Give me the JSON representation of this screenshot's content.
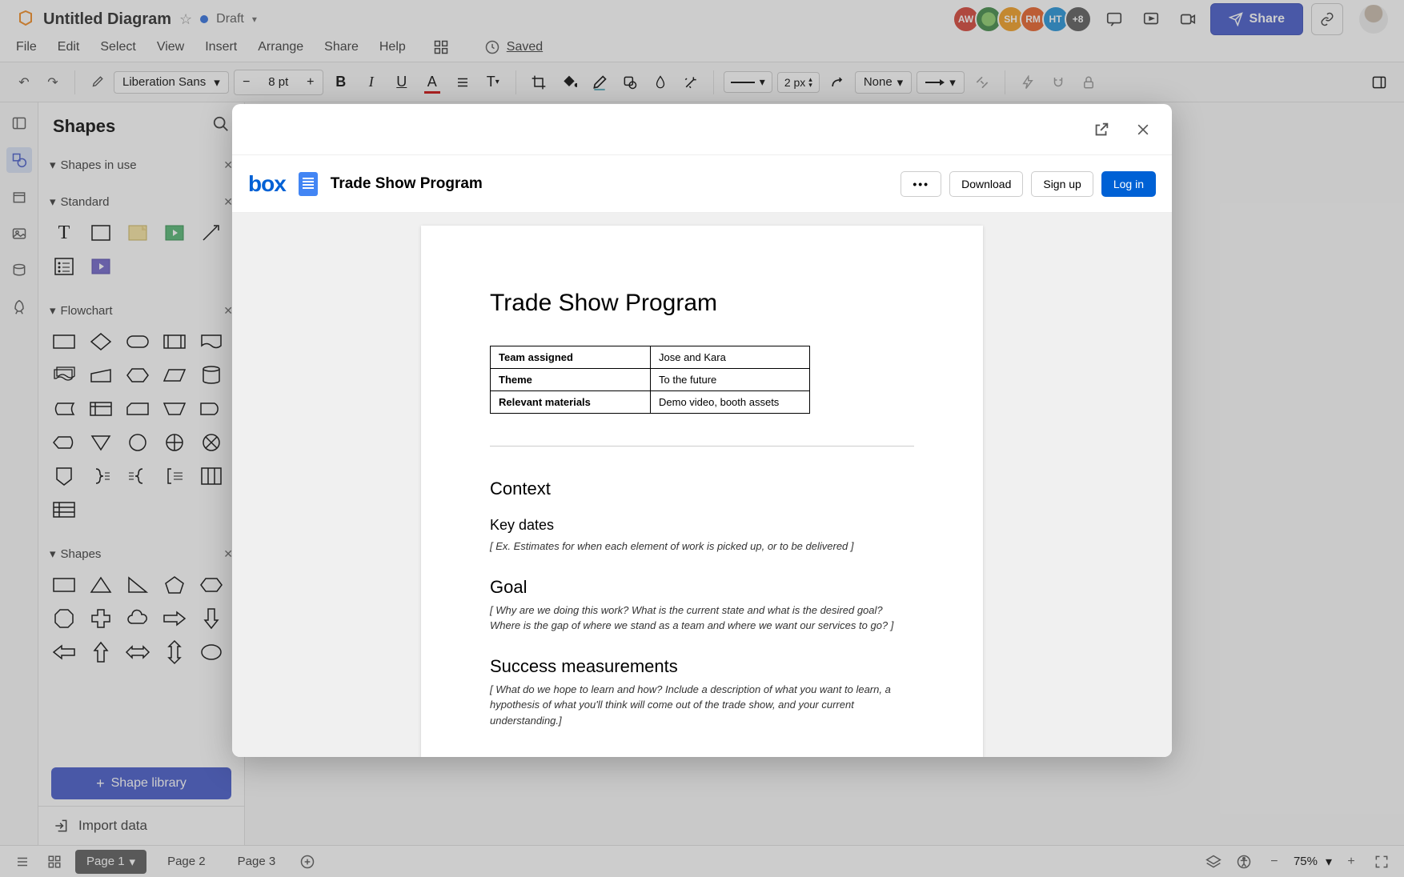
{
  "header": {
    "title": "Untitled Diagram",
    "status": "Draft",
    "saved": "Saved",
    "menus": [
      "File",
      "Edit",
      "Select",
      "View",
      "Insert",
      "Arrange",
      "Share",
      "Help"
    ],
    "avatars": [
      {
        "label": "AW",
        "color": "#d33b2f"
      },
      {
        "label": "",
        "color": "#3a8540"
      },
      {
        "label": "SH",
        "color": "#f09a1a"
      },
      {
        "label": "RM",
        "color": "#e65a1f"
      },
      {
        "label": "HT",
        "color": "#1a8ed6"
      }
    ],
    "avatar_more": "+8",
    "share": "Share"
  },
  "toolbar": {
    "font": "Liberation Sans",
    "size": "8 pt",
    "px": "2 px",
    "none": "None"
  },
  "shapes": {
    "title": "Shapes",
    "sections": {
      "in_use": "Shapes in use",
      "standard": "Standard",
      "flowchart": "Flowchart",
      "shapes": "Shapes"
    },
    "library_btn": "Shape library",
    "import": "Import data"
  },
  "bottom": {
    "pages": [
      "Page 1",
      "Page 2",
      "Page 3"
    ],
    "zoom": "75%"
  },
  "modal": {
    "box_logo": "box",
    "doc_title": "Trade Show Program",
    "buttons": {
      "download": "Download",
      "signup": "Sign up",
      "login": "Log in"
    },
    "doc": {
      "h1": "Trade Show Program",
      "table": [
        {
          "label": "Team assigned",
          "value": "Jose and Kara"
        },
        {
          "label": "Theme",
          "value": "To the future"
        },
        {
          "label": "Relevant materials",
          "value": "Demo video, booth assets"
        }
      ],
      "context": "Context",
      "key_dates": "Key dates",
      "key_dates_note": "[ Ex. Estimates for when each element of work is picked up, or to be delivered ]",
      "goal": "Goal",
      "goal_note": "[ Why are we doing this work? What is the current state and what is the desired goal? Where is the gap of where we stand as a team and where we want our services to go?  ]",
      "success": "Success measurements",
      "success_note": "[ What do we hope to learn and how? Include a description of what you want to learn, a hypothesis of what you'll think will come out of the trade show, and your current understanding.]"
    }
  }
}
